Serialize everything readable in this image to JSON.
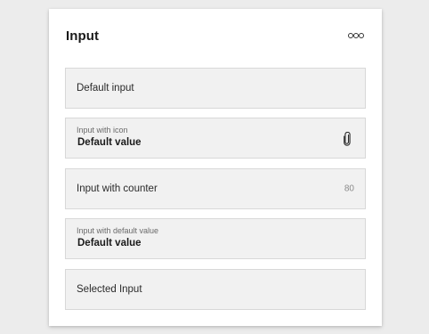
{
  "card": {
    "title": "Input"
  },
  "inputs": [
    {
      "placeholder": "Default input"
    },
    {
      "label": "Input with icon",
      "value": "Default value",
      "icon": "paperclip-icon"
    },
    {
      "placeholder": "Input with counter",
      "counter": "80"
    },
    {
      "label": "Input with default value",
      "value": "Default value"
    },
    {
      "placeholder": "Selected Input"
    }
  ]
}
